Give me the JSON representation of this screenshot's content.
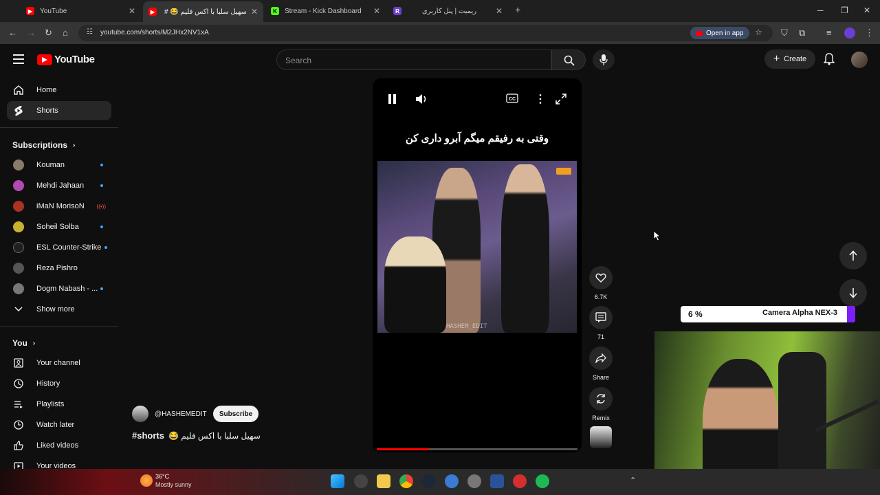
{
  "browser": {
    "tabs": [
      {
        "title": "YouTube",
        "active": false
      },
      {
        "title": "سهیل سلبا با اکس فلیم 😂 #",
        "active": true
      },
      {
        "title": "Stream - Kick Dashboard",
        "active": false
      },
      {
        "title": "ریمیت | پنل کاربری",
        "active": false
      }
    ],
    "url": "youtube.com/shorts/M2JHx2NV1xA",
    "open_in_app": "Open in app"
  },
  "masthead": {
    "logo_text": "YouTube",
    "search_placeholder": "Search",
    "create_label": "Create"
  },
  "sidebar": {
    "main": [
      {
        "label": "Home",
        "icon": "home-icon"
      },
      {
        "label": "Shorts",
        "icon": "shorts-icon",
        "selected": true
      }
    ],
    "subscriptions_heading": "Subscriptions",
    "subscriptions": [
      {
        "label": "Kouman",
        "indicator": "dot",
        "color": "#8a7b6a"
      },
      {
        "label": "Mehdi Jahaan",
        "indicator": "dot",
        "color": "#b04ab0"
      },
      {
        "label": "iMaN MorisoN",
        "indicator": "live",
        "color": "#aa3322"
      },
      {
        "label": "Soheil Solba",
        "indicator": "dot",
        "color": "#c8b030"
      },
      {
        "label": "ESL Counter-Strike",
        "indicator": "dot",
        "color": "#202020"
      },
      {
        "label": "Reza Pishro",
        "indicator": "none",
        "color": "#555555"
      },
      {
        "label": "Dogm Nabash - ...",
        "indicator": "dot",
        "color": "#777777"
      }
    ],
    "show_more": "Show more",
    "you_heading": "You",
    "you": [
      {
        "label": "Your channel",
        "icon": "channel-icon"
      },
      {
        "label": "History",
        "icon": "history-icon"
      },
      {
        "label": "Playlists",
        "icon": "playlists-icon"
      },
      {
        "label": "Watch later",
        "icon": "watch-later-icon"
      },
      {
        "label": "Liked videos",
        "icon": "like-icon"
      },
      {
        "label": "Your videos",
        "icon": "your-videos-icon"
      }
    ]
  },
  "short": {
    "caption": "وقتی به رفیقم میگم آبرو داری کن",
    "watermark": "HASHEM_EDIT",
    "progress": 0.26,
    "channel": "@HASHEMEDIT",
    "subscribe_label": "Subscribe",
    "hashtag": "#shorts",
    "title": "سهیل سلبا با اکس فلیم 😂",
    "actions": {
      "like_count": "6.7K",
      "comment_count": "71",
      "share_label": "Share",
      "remix_label": "Remix"
    }
  },
  "overlay": {
    "percent_label": "6 %",
    "camera_label": "Camera Alpha NEX-3"
  },
  "taskbar": {
    "temperature": "36°C",
    "weather": "Mostly sunny"
  },
  "colors": {
    "accent_red": "#ff0000",
    "live_red": "#ff4e45",
    "dot_blue": "#3ea6ff",
    "overlay_purple": "#7b1fff"
  }
}
